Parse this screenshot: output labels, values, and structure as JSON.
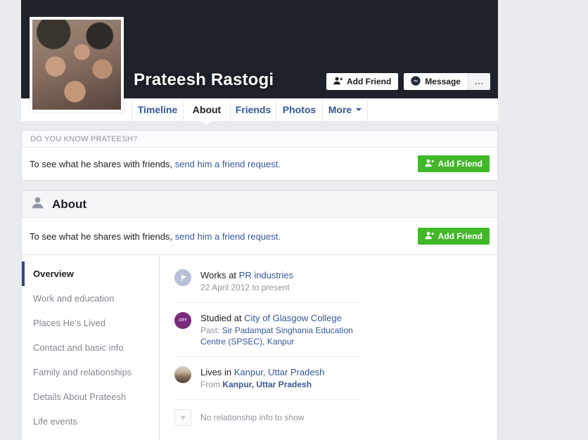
{
  "profile": {
    "name": "Prateesh Rastogi"
  },
  "cover_actions": {
    "add_friend": "Add Friend",
    "message": "Message",
    "more_options": "..."
  },
  "tabs": {
    "timeline": "Timeline",
    "about": "About",
    "friends": "Friends",
    "photos": "Photos",
    "more": "More"
  },
  "know_banner": {
    "header": "DO YOU KNOW PRATEESH?",
    "message": "To see what he shares with friends,",
    "link": "send him a friend request.",
    "add_friend_button": "Add Friend"
  },
  "about": {
    "title": "About",
    "message": "To see what he shares with friends,",
    "link": "send him a friend request.",
    "add_friend_button": "Add Friend",
    "nav": {
      "overview": "Overview",
      "work_education": "Work and education",
      "places_lived": "Places He's Lived",
      "contact_basic": "Contact and basic info",
      "family_relationships": "Family and relationships",
      "details": "Details About Prateesh",
      "life_events": "Life events"
    },
    "work": {
      "prefix": "Works at ",
      "link": "PR industries",
      "sub": "22 April 2012 to present"
    },
    "education": {
      "prefix": "Studied at ",
      "link": "City of Glasgow College",
      "sub_prefix": "Past: ",
      "sub_link": "Sir Padampat Singhania Education Centre (SPSEC), Kanpur",
      "logo_text": "CITY"
    },
    "places": {
      "prefix": "Lives in ",
      "link": "Kanpur, Uttar Pradesh",
      "sub_prefix": "From ",
      "sub_link": "Kanpur, Uttar Pradesh"
    },
    "relationship": {
      "text": "No relationship info to show"
    }
  },
  "icons": {
    "cover_add_friend": "person-plus-icon",
    "cover_message": "messenger-icon",
    "about_header": "person-silhouette-icon",
    "work_entry": "flag-icon",
    "education_entry": "college-logo-icon",
    "places_entry": "city-photo-icon",
    "relationship_entry": "heart-icon"
  },
  "colors": {
    "accent_green": "#42b72a",
    "link_blue": "#365899",
    "cover_dark": "#1e222b",
    "page_background": "#e9ebee",
    "education_logo_purple": "#7b2b7d"
  }
}
